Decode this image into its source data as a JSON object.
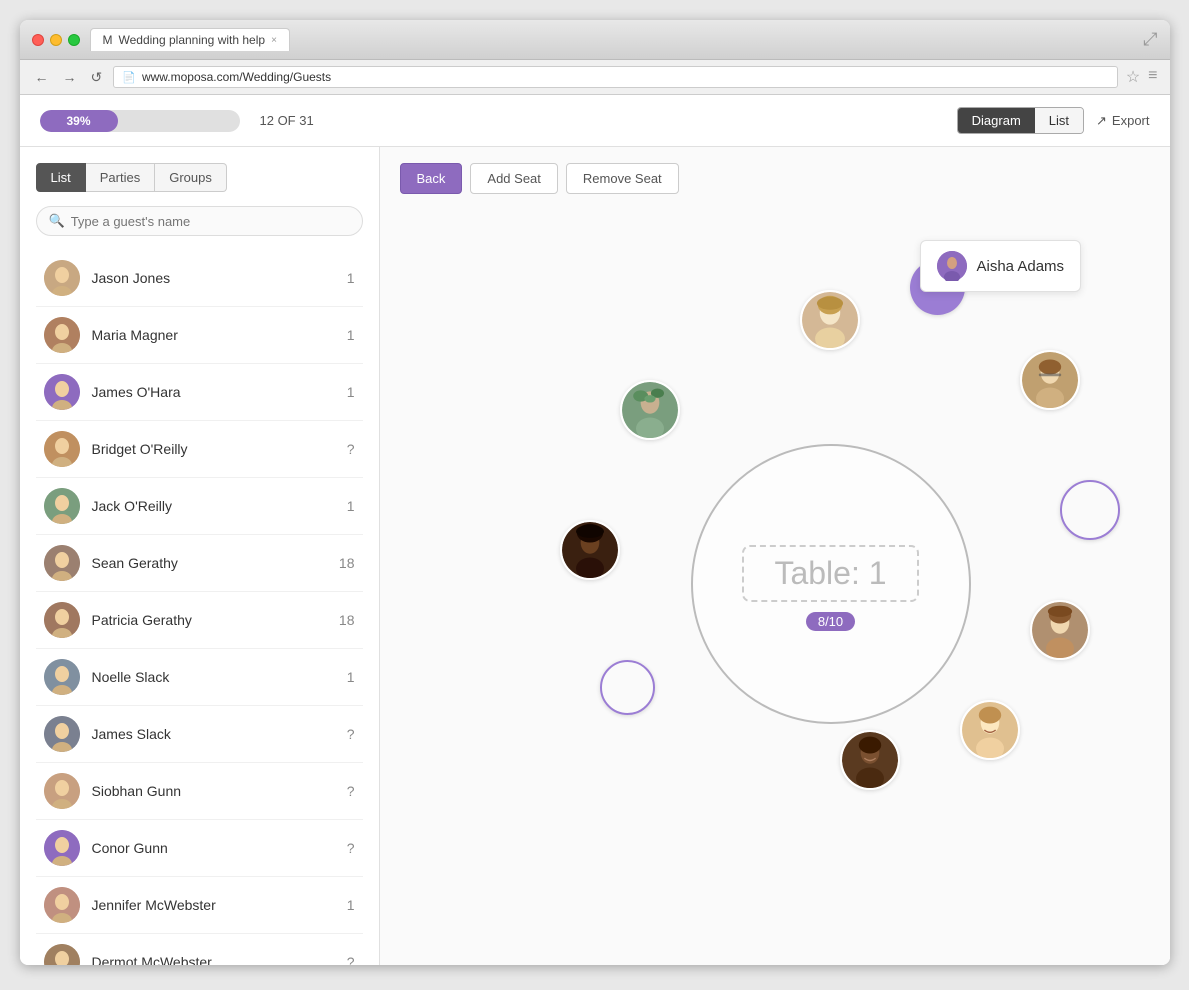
{
  "browser": {
    "tab_title": "Wedding planning with help",
    "url": "www.moposa.com/Wedding/Guests",
    "tab_close": "×"
  },
  "topbar": {
    "progress_pct": 39,
    "progress_label": "39%",
    "count_label": "12 OF 31",
    "diagram_btn": "Diagram",
    "list_btn": "List",
    "export_btn": "Export"
  },
  "sidebar": {
    "tabs": [
      {
        "id": "list",
        "label": "List",
        "active": true
      },
      {
        "id": "parties",
        "label": "Parties",
        "active": false
      },
      {
        "id": "groups",
        "label": "Groups",
        "active": false
      }
    ],
    "search_placeholder": "Type a guest's name",
    "guests": [
      {
        "name": "Jason Jones",
        "table": "1",
        "avatar_bg": "#c8a882"
      },
      {
        "name": "Maria Magner",
        "table": "1",
        "avatar_bg": "#b08060"
      },
      {
        "name": "James O'Hara",
        "table": "1",
        "avatar_bg": "#8e6bbf"
      },
      {
        "name": "Bridget O'Reilly",
        "table": "?",
        "avatar_bg": "#c09060"
      },
      {
        "name": "Jack O'Reilly",
        "table": "1",
        "avatar_bg": "#7a9e7e"
      },
      {
        "name": "Sean Gerathy",
        "table": "18",
        "avatar_bg": "#9b8070"
      },
      {
        "name": "Patricia Gerathy",
        "table": "18",
        "avatar_bg": "#a07860"
      },
      {
        "name": "Noelle Slack",
        "table": "1",
        "avatar_bg": "#8090a0"
      },
      {
        "name": "James Slack",
        "table": "?",
        "avatar_bg": "#7a8090"
      },
      {
        "name": "Siobhan Gunn",
        "table": "?",
        "avatar_bg": "#c8a080"
      },
      {
        "name": "Conor Gunn",
        "table": "?",
        "avatar_bg": "#8e6bbf"
      },
      {
        "name": "Jennifer McWebster",
        "table": "1",
        "avatar_bg": "#c09080"
      },
      {
        "name": "Dermot McWebster",
        "table": "?",
        "avatar_bg": "#a08060"
      }
    ]
  },
  "diagram": {
    "back_btn": "Back",
    "add_seat_btn": "Add Seat",
    "remove_seat_btn": "Remove Seat",
    "table_label": "Table: 1",
    "table_count": "8/10",
    "tooltip_name": "Aisha Adams"
  }
}
